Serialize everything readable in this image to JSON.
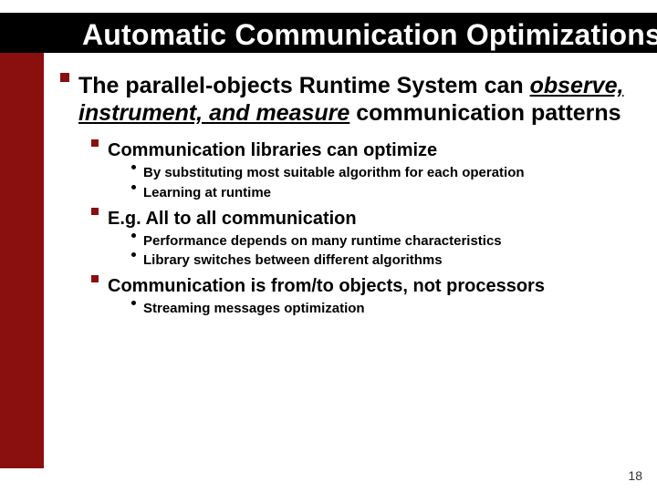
{
  "title": "Automatic Communication Optimizations",
  "lvl1_pre": "The parallel-objects Runtime System can ",
  "lvl1_u": "observe, instrument, and measure",
  "lvl1_post": " communication patterns",
  "sec1": "Communication libraries can optimize",
  "sec1_b1": "By substituting most suitable algorithm for each operation",
  "sec1_b2": "Learning at runtime",
  "sec2": "E.g. All to all communication",
  "sec2_b1": "Performance depends on many runtime characteristics",
  "sec2_b2": "Library switches between different algorithms",
  "sec3": "Communication is from/to objects, not processors",
  "sec3_b1": "Streaming messages optimization",
  "page": "18"
}
